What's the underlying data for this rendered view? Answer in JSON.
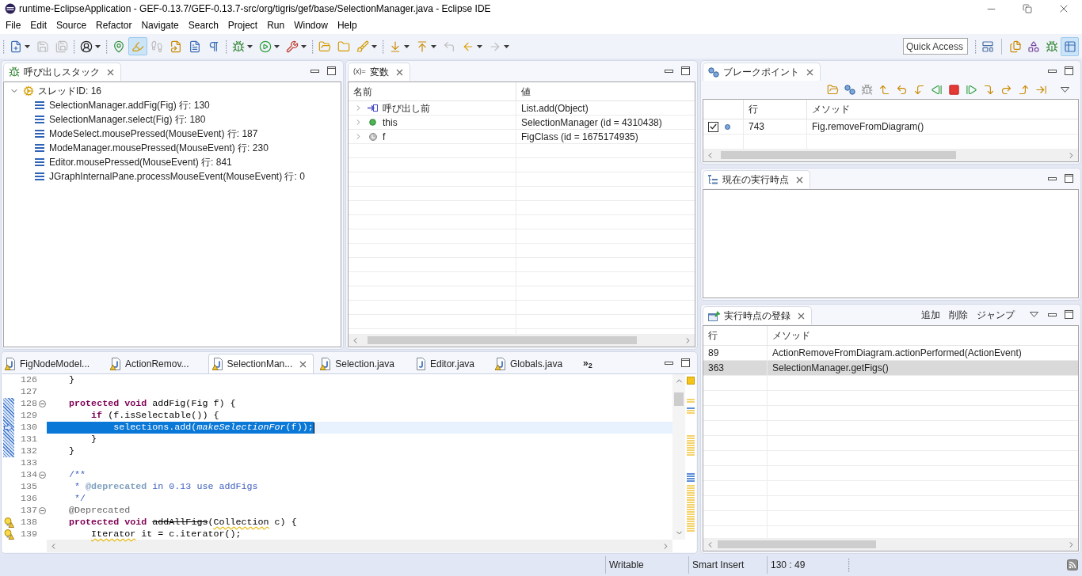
{
  "window": {
    "title": "runtime-EclipseApplication - GEF-0.13.7/GEF-0.13.7-src/org/tigris/gef/base/SelectionManager.java - Eclipse IDE"
  },
  "menu": [
    "File",
    "Edit",
    "Source",
    "Refactor",
    "Navigate",
    "Search",
    "Project",
    "Run",
    "Window",
    "Help"
  ],
  "toolbar": {
    "groups": [
      [
        {
          "dropdown": true,
          "disabled": false,
          "pressed": false
        },
        {
          "dropdown": false,
          "disabled": true,
          "pressed": false
        },
        {
          "dropdown": false,
          "disabled": true,
          "pressed": false
        }
      ],
      [
        {
          "dropdown": true,
          "disabled": false,
          "pressed": false
        }
      ],
      [
        {
          "dropdown": false,
          "disabled": false,
          "pressed": false
        },
        {
          "dropdown": false,
          "disabled": false,
          "pressed": true
        },
        {
          "dropdown": false,
          "disabled": true,
          "pressed": false
        },
        {
          "dropdown": false,
          "disabled": false,
          "pressed": false
        },
        {
          "dropdown": false,
          "disabled": false,
          "pressed": false
        },
        {
          "dropdown": false,
          "disabled": false,
          "pressed": false
        }
      ],
      [
        {
          "dropdown": true,
          "disabled": false,
          "pressed": false
        },
        {
          "dropdown": true,
          "disabled": false,
          "pressed": false
        },
        {
          "dropdown": true,
          "disabled": false,
          "pressed": false
        }
      ],
      [
        {
          "dropdown": false,
          "disabled": false,
          "pressed": false
        },
        {
          "dropdown": false,
          "disabled": false,
          "pressed": false
        },
        {
          "dropdown": true,
          "disabled": false,
          "pressed": false
        }
      ],
      [
        {
          "dropdown": true,
          "disabled": false,
          "pressed": false
        },
        {
          "dropdown": true,
          "disabled": false,
          "pressed": false
        },
        {
          "dropdown": false,
          "disabled": true,
          "pressed": false
        },
        {
          "dropdown": true,
          "disabled": false,
          "pressed": false
        },
        {
          "dropdown": true,
          "disabled": true,
          "pressed": false
        }
      ]
    ]
  },
  "quick_access": {
    "placeholder": "Quick Access"
  },
  "perspectives": [
    {
      "selected": false
    },
    {
      "selected": false
    },
    {
      "selected": false
    },
    {
      "selected": true
    }
  ],
  "call_stack": {
    "title": "呼び出しスタック",
    "threads": [
      {
        "label": "スレッドID: 16",
        "expanded": true,
        "children": [
          {
            "label": "SelectionManager.addFig(Fig) 行: 130"
          },
          {
            "label": "SelectionManager.select(Fig) 行: 180"
          },
          {
            "label": "ModeSelect.mousePressed(MouseEvent) 行: 187"
          },
          {
            "label": "ModeManager.mousePressed(MouseEvent) 行: 230"
          },
          {
            "label": "Editor.mousePressed(MouseEvent) 行: 841"
          },
          {
            "label": "JGraphInternalPane.processMouseEvent(MouseEvent) 行: 0"
          }
        ]
      }
    ]
  },
  "variables": {
    "icon_glyph": "(x)=",
    "title": "変数",
    "columns": [
      "名前",
      "値"
    ],
    "rows": [
      {
        "kind": "return",
        "name": "呼び出し前",
        "value": "List.add(Object)",
        "expanded": false
      },
      {
        "kind": "field",
        "name": "this",
        "value": "SelectionManager (id = 4310438)",
        "expanded": false
      },
      {
        "kind": "local",
        "name": "f",
        "value": "FigClass (id = 1675174935)",
        "expanded": false
      }
    ]
  },
  "breakpoints": {
    "title": "ブレークポイント",
    "columns": [
      "行",
      "メソッド"
    ],
    "rows": [
      {
        "checked": true,
        "line": "743",
        "method": "Fig.removeFromDiagram()"
      }
    ]
  },
  "current_point": {
    "title": "現在の実行時点"
  },
  "registered_points": {
    "title": "実行時点の登録",
    "actions": [
      "追加",
      "削除",
      "ジャンプ"
    ],
    "columns": [
      "行",
      "メソッド"
    ],
    "rows": [
      {
        "line": "89",
        "method": "ActionRemoveFromDiagram.actionPerformed(ActionEvent)",
        "selected": false
      },
      {
        "line": "363",
        "method": "SelectionManager.getFigs()",
        "selected": true
      }
    ]
  },
  "editor": {
    "tabs": [
      {
        "title": "FigNodeModel...",
        "selected": false,
        "warning": true
      },
      {
        "title": "ActionRemov...",
        "selected": false,
        "warning": true
      },
      {
        "title": "SelectionMan...",
        "selected": true,
        "warning": true
      },
      {
        "title": "Selection.java",
        "selected": false,
        "warning": true
      },
      {
        "title": "Editor.java",
        "selected": false,
        "warning": false
      },
      {
        "title": "Globals.java",
        "selected": false,
        "warning": true
      }
    ],
    "overflow": "»$_{2}$",
    "lines": [
      {
        "number": "126",
        "segments": [
          {
            "kind": "plain",
            "text": "    }"
          }
        ],
        "current": false,
        "range": false,
        "warning": false,
        "fold_marker": false
      },
      {
        "number": "127",
        "current": false,
        "range": false,
        "warning": false,
        "fold_marker": false
      },
      {
        "number": "128",
        "segments": [
          {
            "kind": "keyword",
            "text": "    protected void"
          },
          {
            "kind": "plain",
            "text": " addFig(Fig f) {"
          }
        ],
        "current": false,
        "range": true,
        "warning": false,
        "fold_marker": true
      },
      {
        "number": "129",
        "segments": [
          {
            "kind": "keyword",
            "text": "        if"
          },
          {
            "kind": "plain",
            "text": " (f.isSelectable()) {"
          }
        ],
        "current": false,
        "range": true,
        "warning": false,
        "fold_marker": false
      },
      {
        "number": "130",
        "segments": [
          {
            "kind": "plain",
            "text": "            selections.add("
          },
          {
            "kind": "static",
            "text": "makeSelectionFor"
          },
          {
            "kind": "plain",
            "text": "(f));"
          }
        ],
        "current": true,
        "range": true,
        "warning": false,
        "fold_marker": false
      },
      {
        "number": "131",
        "segments": [
          {
            "kind": "plain",
            "text": "        }"
          }
        ],
        "current": false,
        "range": true,
        "warning": false,
        "fold_marker": false
      },
      {
        "number": "132",
        "segments": [
          {
            "kind": "plain",
            "text": "    }"
          }
        ],
        "current": false,
        "range": true,
        "warning": false,
        "fold_marker": false
      },
      {
        "number": "133",
        "current": false,
        "range": false,
        "warning": false,
        "fold_marker": false
      },
      {
        "number": "134",
        "segments": [
          {
            "kind": "doc",
            "text": "    /**"
          }
        ],
        "current": false,
        "range": false,
        "warning": false,
        "fold_marker": true
      },
      {
        "number": "135",
        "segments": [
          {
            "kind": "doc",
            "text": "     * "
          },
          {
            "kind": "doctag",
            "text": "@deprecated"
          },
          {
            "kind": "doc",
            "text": " in 0.13 use addFigs"
          }
        ],
        "current": false,
        "range": false,
        "warning": false,
        "fold_marker": false
      },
      {
        "number": "136",
        "segments": [
          {
            "kind": "doc",
            "text": "     */"
          }
        ],
        "current": false,
        "range": false,
        "warning": false,
        "fold_marker": false
      },
      {
        "number": "137",
        "segments": [
          {
            "kind": "annotation",
            "text": "    @Deprecated"
          }
        ],
        "current": false,
        "range": false,
        "warning": false,
        "fold_marker": true
      },
      {
        "number": "138",
        "segments": [
          {
            "kind": "keyword",
            "text": "    protected void"
          },
          {
            "kind": "deprecated",
            "text": " addAllFigs"
          },
          {
            "kind": "plain",
            "text": "("
          },
          {
            "kind": "warn",
            "text": "Collection"
          },
          {
            "kind": "plain",
            "text": " c) {"
          }
        ],
        "current": false,
        "range": false,
        "warning": true,
        "fold_marker": false
      },
      {
        "number": "139",
        "segments": [
          {
            "kind": "warn",
            "text": "        Iterator"
          },
          {
            "kind": "plain",
            "text": " it = c.iterator();"
          }
        ],
        "current": false,
        "range": false,
        "warning": true,
        "fold_marker": false
      }
    ]
  },
  "status_bar": {
    "fields": [
      "Writable",
      "Smart Insert",
      "130 : 49"
    ]
  }
}
